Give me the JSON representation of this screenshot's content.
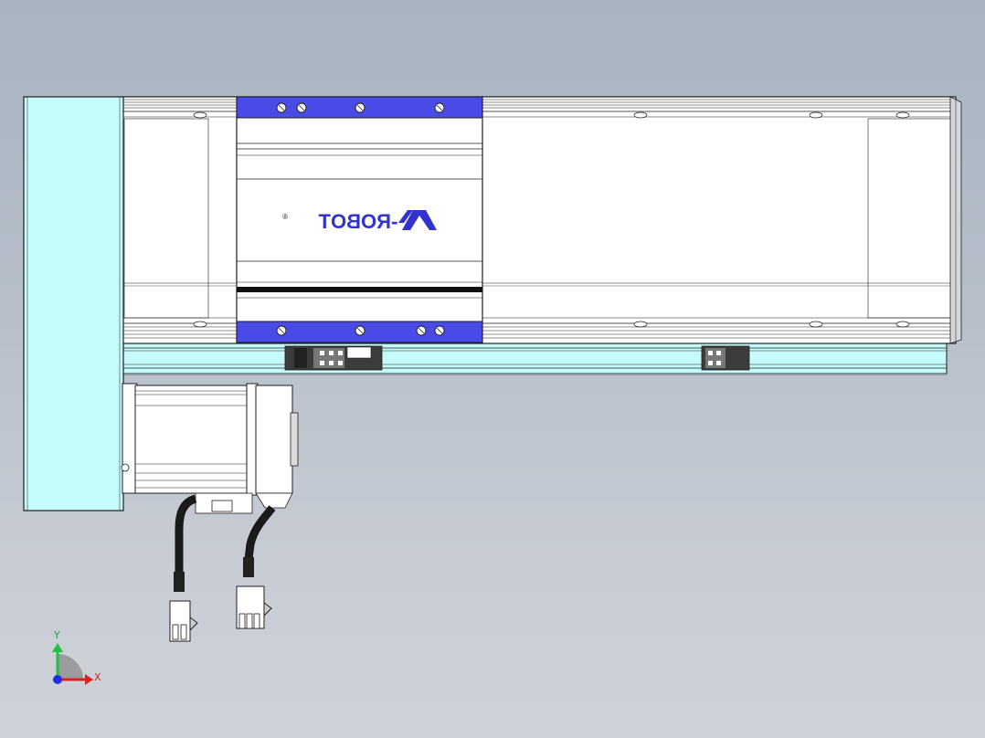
{
  "logo": {
    "text": "-ROBOT",
    "registered": "®"
  },
  "triad": {
    "x_label": "X",
    "y_label": "Y"
  },
  "colors": {
    "end_cap": "#c6fbfb",
    "carriage_plate": "#4a4ae6",
    "logo": "#3232d0",
    "base_rail": "#c6fbfb",
    "body": "#ffffff",
    "outline": "#1e1e1e",
    "axis_x": "#e02020",
    "axis_y": "#20c040",
    "axis_origin": "#2030e0"
  }
}
